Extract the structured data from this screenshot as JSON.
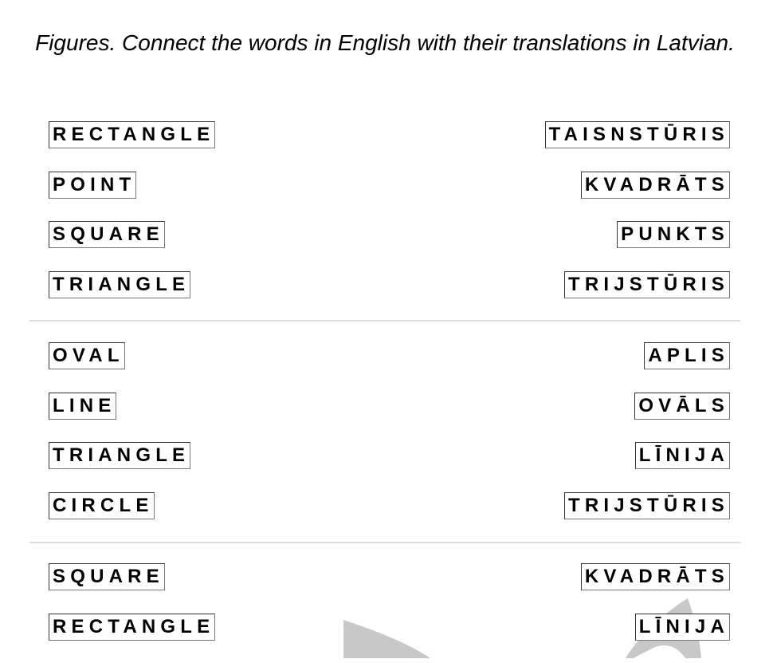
{
  "instruction": "Figures. Connect the words in English with their translations in Latvian.",
  "groups": [
    {
      "english": [
        "RECTANGLE",
        "POINT",
        "SQUARE",
        "TRIANGLE"
      ],
      "latvian": [
        "TAISNSTŪRIS",
        "KVADRĀTS",
        "PUNKTS",
        "TRIJSTŪRIS"
      ]
    },
    {
      "english": [
        "OVAL",
        "LINE",
        "TRIANGLE",
        "CIRCLE"
      ],
      "latvian": [
        "APLIS",
        "OVĀLS",
        "LĪNIJA",
        "TRIJSTŪRIS"
      ]
    },
    {
      "english": [
        "SQUARE",
        "RECTANGLE"
      ],
      "latvian": [
        "KVADRĀTS",
        "LĪNIJA"
      ]
    }
  ],
  "colors": {
    "text": "#000000",
    "box_border": "#333333",
    "divider": "#dcdcdc",
    "watermark": "#c8c8c8"
  }
}
